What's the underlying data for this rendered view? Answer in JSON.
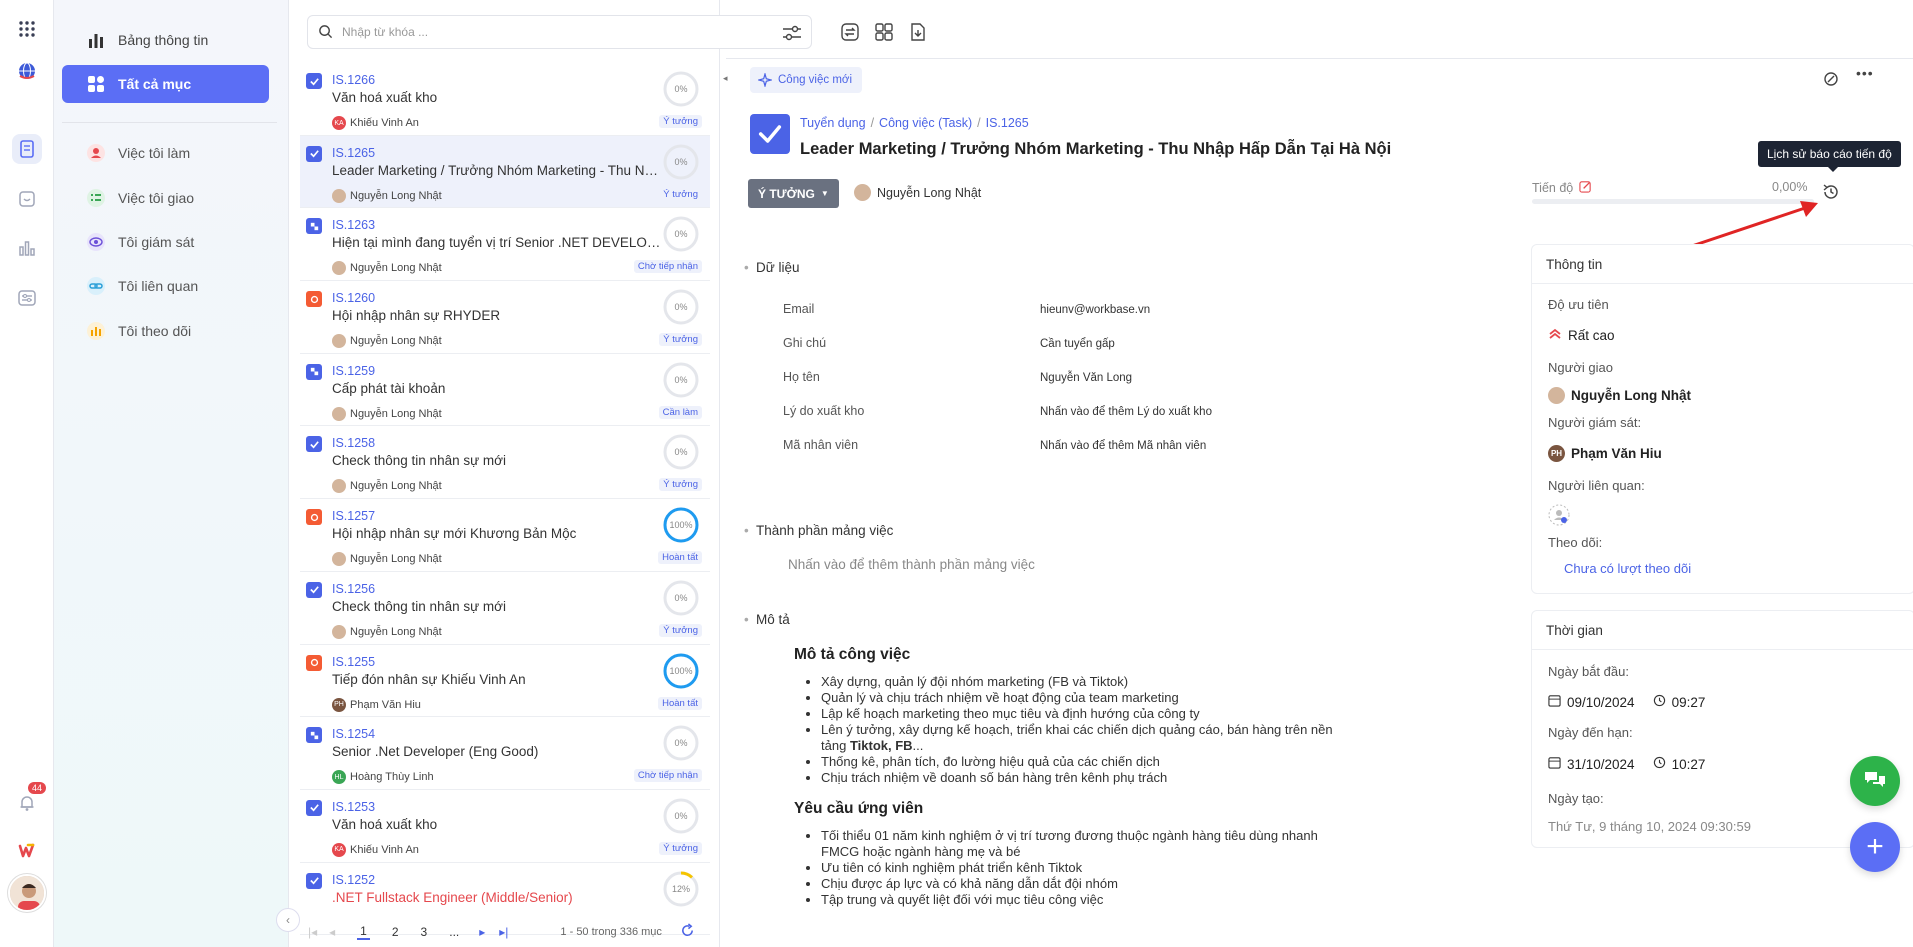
{
  "rail": {
    "notif_count": "44"
  },
  "menu": {
    "items": [
      {
        "label": "Bảng thông tin"
      },
      {
        "label": "Tất cả mục"
      },
      {
        "label": "Việc tôi làm"
      },
      {
        "label": "Việc tôi giao"
      },
      {
        "label": "Tôi giám sát"
      },
      {
        "label": "Tôi liên quan"
      },
      {
        "label": "Tôi theo dõi"
      }
    ]
  },
  "search": {
    "placeholder": "Nhập từ khóa ..."
  },
  "list": [
    {
      "code": "IS.1266",
      "title": "Văn hoá xuất kho",
      "person": "Khiếu Vinh An",
      "initials": "KA",
      "avcolor": "#e5484d",
      "pct": "0%",
      "progress": 0,
      "status": "Ý tưởng",
      "type": "check"
    },
    {
      "code": "IS.1265",
      "title": "Leader Marketing / Trưởng Nhóm Marketing - Thu Nhập Hấp Dẫn Tại Hà Nội",
      "person": "Nguyễn Long Nhật",
      "initials": "",
      "avcolor": "#d3b59c",
      "pct": "0%",
      "progress": 0,
      "status": "Ý tưởng",
      "type": "check"
    },
    {
      "code": "IS.1263",
      "title": "Hiện tại mình đang tuyển vị trí Senior .NET DEVELOPER",
      "person": "Nguyễn Long Nhật",
      "initials": "",
      "avcolor": "#d3b59c",
      "pct": "0%",
      "progress": 0,
      "status": "Chờ tiếp nhận",
      "type": "grid"
    },
    {
      "code": "IS.1260",
      "title": "Hội nhập nhân sự RHYDER",
      "person": "Nguyễn Long Nhật",
      "initials": "",
      "avcolor": "#d3b59c",
      "pct": "0%",
      "progress": 0,
      "status": "Ý tưởng",
      "type": "orange"
    },
    {
      "code": "IS.1259",
      "title": "Cấp phát tài khoản",
      "person": "Nguyễn Long Nhật",
      "initials": "",
      "avcolor": "#d3b59c",
      "pct": "0%",
      "progress": 0,
      "status": "Cần làm",
      "type": "grid"
    },
    {
      "code": "IS.1258",
      "title": "Check thông tin nhân sự mới",
      "person": "Nguyễn Long Nhật",
      "initials": "",
      "avcolor": "#d3b59c",
      "pct": "0%",
      "progress": 0,
      "status": "Ý tưởng",
      "type": "check"
    },
    {
      "code": "IS.1257",
      "title": "Hội nhập nhân sự mới Khương Bản Mộc",
      "person": "Nguyễn Long Nhật",
      "initials": "",
      "avcolor": "#d3b59c",
      "pct": "100%",
      "progress": 100,
      "status": "Hoàn tất",
      "type": "orange"
    },
    {
      "code": "IS.1256",
      "title": "Check thông tin nhân sự mới",
      "person": "Nguyễn Long Nhật",
      "initials": "",
      "avcolor": "#d3b59c",
      "pct": "0%",
      "progress": 0,
      "status": "Ý tưởng",
      "type": "check"
    },
    {
      "code": "IS.1255",
      "title": "Tiếp đón nhân sự Khiếu Vinh An",
      "person": "Phạm Văn Hiu",
      "initials": "PH",
      "avcolor": "#7a5540",
      "pct": "100%",
      "progress": 100,
      "status": "Hoàn tất",
      "type": "orange"
    },
    {
      "code": "IS.1254",
      "title": "Senior .Net Developer (Eng Good)",
      "person": "Hoàng Thùy Linh",
      "initials": "HL",
      "avcolor": "#3aa655",
      "pct": "0%",
      "progress": 0,
      "status": "Chờ tiếp nhận",
      "type": "grid"
    },
    {
      "code": "IS.1253",
      "title": "Văn hoá xuất kho",
      "person": "Khiếu Vinh An",
      "initials": "KA",
      "avcolor": "#e5484d",
      "pct": "0%",
      "progress": 0,
      "status": "Ý tưởng",
      "type": "check"
    },
    {
      "code": "IS.1252",
      "title": ".NET Fullstack Engineer (Middle/Senior)",
      "person": "",
      "initials": "",
      "avcolor": "#d3b59c",
      "pct": "12%",
      "progress": 12,
      "status": "",
      "type": "check",
      "red": true
    }
  ],
  "pager": {
    "pages": [
      "1",
      "2",
      "3",
      "..."
    ],
    "summary": "1 - 50 trong 336 mục"
  },
  "detail": {
    "new_task": "Công việc mới",
    "breadcrumb": [
      "Tuyển dụng",
      "Công việc (Task)",
      "IS.1265"
    ],
    "title": "Leader Marketing / Trưởng Nhóm Marketing - Thu Nhập Hấp Dẫn Tại Hà Nội",
    "status": "Ý TƯỞNG",
    "owner": "Nguyễn Long Nhật",
    "progress_label": "Tiến độ",
    "progress_value": "0,00%",
    "progress_fraction": 0,
    "tooltip": "Lịch sử báo cáo tiến độ",
    "sections": {
      "data": "Dữ liệu",
      "components": "Thành phần mảng việc",
      "description": "Mô tả"
    },
    "fields": [
      {
        "label": "Email",
        "value": "hieunv@workbase.vn"
      },
      {
        "label": "Ghi chú",
        "value": "Cần tuyển gấp"
      },
      {
        "label": "Họ tên",
        "value": "Nguyễn Văn Long"
      },
      {
        "label": "Lý do xuất kho",
        "value": "Nhấn vào để thêm Lý do xuất kho"
      },
      {
        "label": "Mã nhân viên",
        "value": "Nhấn vào để thêm Mã nhân viên"
      }
    ],
    "add_component": "Nhấn vào để thêm thành phần mảng việc",
    "desc": {
      "h1": "Mô tả công việc",
      "list1": [
        "Xây dựng, quản lý đội nhóm marketing (FB và Tiktok)",
        "Quản lý và chịu trách nhiệm về hoạt động của team marketing",
        "Lập kế hoạch marketing theo mục tiêu và định hướng của công ty",
        "Lên ý tưởng, xây dựng kế hoạch, triển khai các chiến dịch quảng cáo, bán hàng trên nền tảng",
        "Thống kê, phân tích, đo lường hiệu quả của các chiến dịch",
        "Chịu trách nhiệm về doanh số bán hàng trên kênh phụ trách"
      ],
      "bold_tail": "Tiktok, FB",
      "ellipsis": "...",
      "h2": "Yêu cầu ứng viên",
      "list2": [
        "Tối thiểu 01 năm kinh nghiệm ở vị trí tương đương thuộc ngành hàng tiêu dùng nhanh FMCG hoặc ngành hàng mẹ và bé",
        "Ưu tiên có kinh nghiệm phát triển kênh Tiktok",
        "Chịu được áp lực và có khả năng dẫn dắt đội nhóm",
        "Tập trung và quyết liệt đối với mục tiêu công việc"
      ]
    }
  },
  "info": {
    "header": "Thông tin",
    "priority_label": "Độ ưu tiên",
    "priority": "Rất cao",
    "assigner_label": "Người giao",
    "assigner": "Nguyễn Long Nhật",
    "supervisor_label": "Người giám sát:",
    "supervisor": "Phạm Văn Hiu",
    "supervisor_initials": "PH",
    "related_label": "Người liên quan:",
    "follow_label": "Theo dõi:",
    "follow_link": "Chưa có lượt theo dõi"
  },
  "time": {
    "header": "Thời gian",
    "start_label": "Ngày bắt đầu:",
    "start_date": "09/10/2024",
    "start_time": "09:27",
    "due_label": "Ngày đến hạn:",
    "due_date": "31/10/2024",
    "due_time": "10:27",
    "created_label": "Ngày tạo:",
    "created": "Thứ Tư, 9 tháng 10, 2024 09:30:59"
  },
  "colors": {
    "accent": "#5b6ef5",
    "link": "#4b63e6",
    "fab_chat": "#2db34a",
    "fab_add": "#5b6ef5"
  }
}
